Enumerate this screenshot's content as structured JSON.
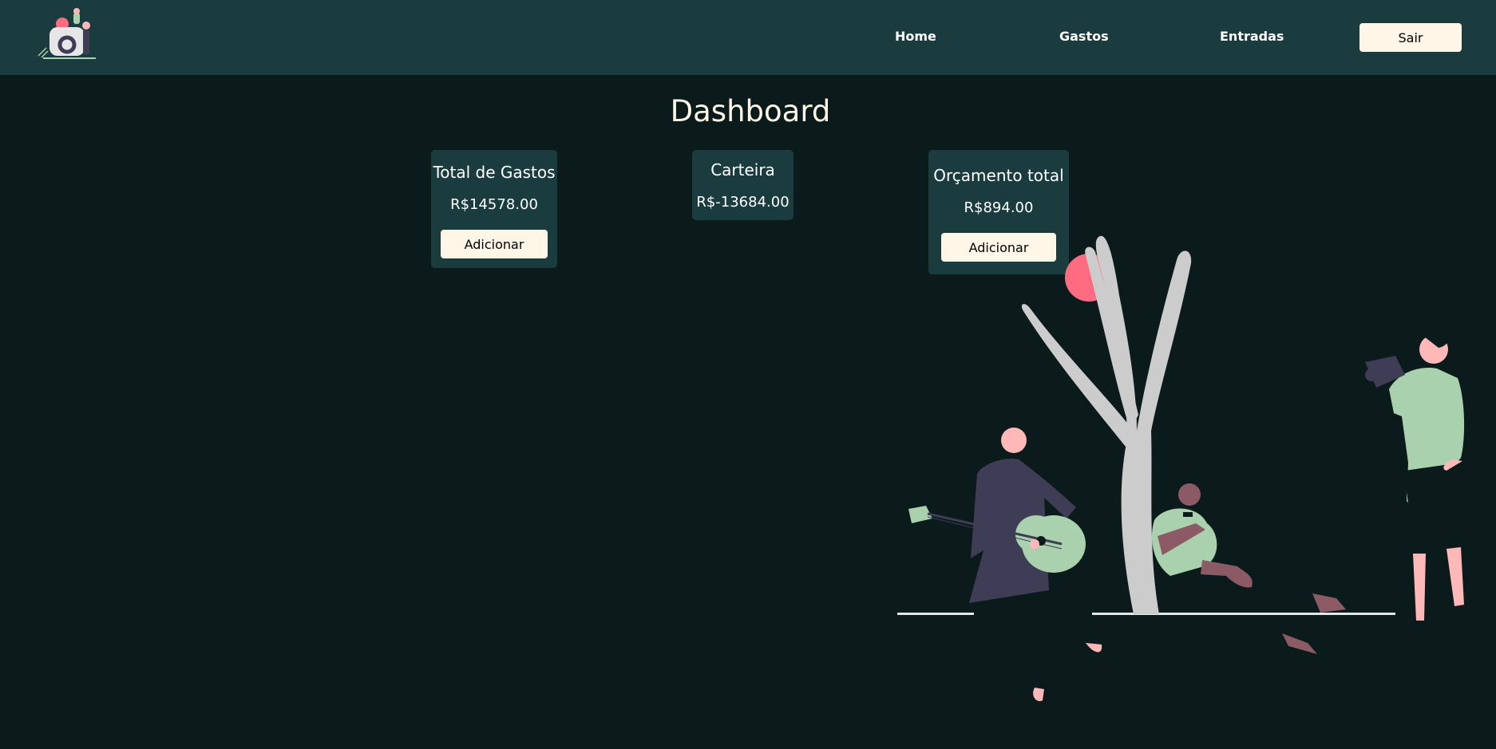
{
  "nav": {
    "home": "Home",
    "gastos": "Gastos",
    "entradas": "Entradas",
    "sair": "Sair"
  },
  "page": {
    "title": "Dashboard"
  },
  "cards": {
    "gastos": {
      "title": "Total de Gastos",
      "value": "R$14578.00",
      "button": "Adicionar"
    },
    "carteira": {
      "title": "Carteira",
      "value": "R$-13684.00"
    },
    "orcamento": {
      "title": "Orçamento total",
      "value": "R$894.00",
      "button": "Adicionar"
    }
  },
  "colors": {
    "navbar": "#1b3c3f",
    "background": "#0b1a1b",
    "button": "#fff6e7",
    "accent_green": "#a9d1ae",
    "accent_pink": "#ff6b81"
  }
}
